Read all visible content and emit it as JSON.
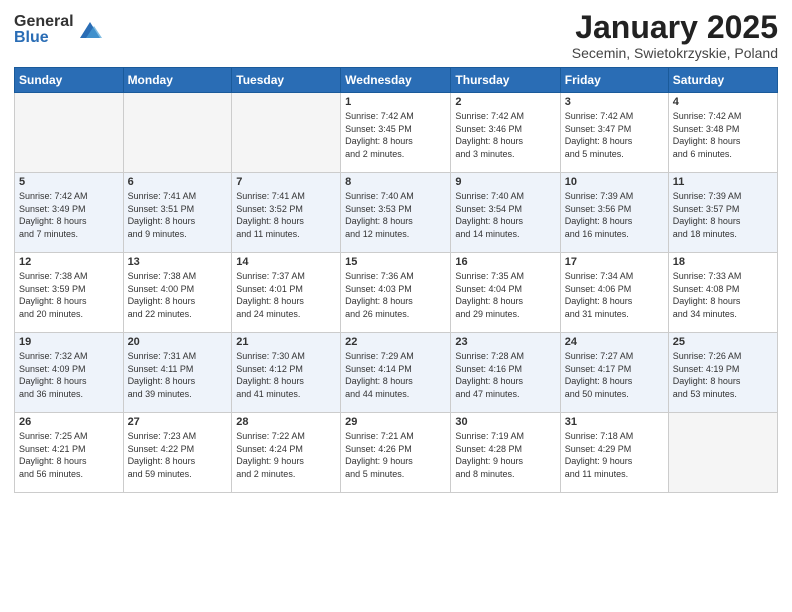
{
  "logo": {
    "general": "General",
    "blue": "Blue"
  },
  "title": "January 2025",
  "subtitle": "Secemin, Swietokrzyskie, Poland",
  "days_header": [
    "Sunday",
    "Monday",
    "Tuesday",
    "Wednesday",
    "Thursday",
    "Friday",
    "Saturday"
  ],
  "weeks": [
    [
      {
        "day": "",
        "info": ""
      },
      {
        "day": "",
        "info": ""
      },
      {
        "day": "",
        "info": ""
      },
      {
        "day": "1",
        "info": "Sunrise: 7:42 AM\nSunset: 3:45 PM\nDaylight: 8 hours\nand 2 minutes."
      },
      {
        "day": "2",
        "info": "Sunrise: 7:42 AM\nSunset: 3:46 PM\nDaylight: 8 hours\nand 3 minutes."
      },
      {
        "day": "3",
        "info": "Sunrise: 7:42 AM\nSunset: 3:47 PM\nDaylight: 8 hours\nand 5 minutes."
      },
      {
        "day": "4",
        "info": "Sunrise: 7:42 AM\nSunset: 3:48 PM\nDaylight: 8 hours\nand 6 minutes."
      }
    ],
    [
      {
        "day": "5",
        "info": "Sunrise: 7:42 AM\nSunset: 3:49 PM\nDaylight: 8 hours\nand 7 minutes."
      },
      {
        "day": "6",
        "info": "Sunrise: 7:41 AM\nSunset: 3:51 PM\nDaylight: 8 hours\nand 9 minutes."
      },
      {
        "day": "7",
        "info": "Sunrise: 7:41 AM\nSunset: 3:52 PM\nDaylight: 8 hours\nand 11 minutes."
      },
      {
        "day": "8",
        "info": "Sunrise: 7:40 AM\nSunset: 3:53 PM\nDaylight: 8 hours\nand 12 minutes."
      },
      {
        "day": "9",
        "info": "Sunrise: 7:40 AM\nSunset: 3:54 PM\nDaylight: 8 hours\nand 14 minutes."
      },
      {
        "day": "10",
        "info": "Sunrise: 7:39 AM\nSunset: 3:56 PM\nDaylight: 8 hours\nand 16 minutes."
      },
      {
        "day": "11",
        "info": "Sunrise: 7:39 AM\nSunset: 3:57 PM\nDaylight: 8 hours\nand 18 minutes."
      }
    ],
    [
      {
        "day": "12",
        "info": "Sunrise: 7:38 AM\nSunset: 3:59 PM\nDaylight: 8 hours\nand 20 minutes."
      },
      {
        "day": "13",
        "info": "Sunrise: 7:38 AM\nSunset: 4:00 PM\nDaylight: 8 hours\nand 22 minutes."
      },
      {
        "day": "14",
        "info": "Sunrise: 7:37 AM\nSunset: 4:01 PM\nDaylight: 8 hours\nand 24 minutes."
      },
      {
        "day": "15",
        "info": "Sunrise: 7:36 AM\nSunset: 4:03 PM\nDaylight: 8 hours\nand 26 minutes."
      },
      {
        "day": "16",
        "info": "Sunrise: 7:35 AM\nSunset: 4:04 PM\nDaylight: 8 hours\nand 29 minutes."
      },
      {
        "day": "17",
        "info": "Sunrise: 7:34 AM\nSunset: 4:06 PM\nDaylight: 8 hours\nand 31 minutes."
      },
      {
        "day": "18",
        "info": "Sunrise: 7:33 AM\nSunset: 4:08 PM\nDaylight: 8 hours\nand 34 minutes."
      }
    ],
    [
      {
        "day": "19",
        "info": "Sunrise: 7:32 AM\nSunset: 4:09 PM\nDaylight: 8 hours\nand 36 minutes."
      },
      {
        "day": "20",
        "info": "Sunrise: 7:31 AM\nSunset: 4:11 PM\nDaylight: 8 hours\nand 39 minutes."
      },
      {
        "day": "21",
        "info": "Sunrise: 7:30 AM\nSunset: 4:12 PM\nDaylight: 8 hours\nand 41 minutes."
      },
      {
        "day": "22",
        "info": "Sunrise: 7:29 AM\nSunset: 4:14 PM\nDaylight: 8 hours\nand 44 minutes."
      },
      {
        "day": "23",
        "info": "Sunrise: 7:28 AM\nSunset: 4:16 PM\nDaylight: 8 hours\nand 47 minutes."
      },
      {
        "day": "24",
        "info": "Sunrise: 7:27 AM\nSunset: 4:17 PM\nDaylight: 8 hours\nand 50 minutes."
      },
      {
        "day": "25",
        "info": "Sunrise: 7:26 AM\nSunset: 4:19 PM\nDaylight: 8 hours\nand 53 minutes."
      }
    ],
    [
      {
        "day": "26",
        "info": "Sunrise: 7:25 AM\nSunset: 4:21 PM\nDaylight: 8 hours\nand 56 minutes."
      },
      {
        "day": "27",
        "info": "Sunrise: 7:23 AM\nSunset: 4:22 PM\nDaylight: 8 hours\nand 59 minutes."
      },
      {
        "day": "28",
        "info": "Sunrise: 7:22 AM\nSunset: 4:24 PM\nDaylight: 9 hours\nand 2 minutes."
      },
      {
        "day": "29",
        "info": "Sunrise: 7:21 AM\nSunset: 4:26 PM\nDaylight: 9 hours\nand 5 minutes."
      },
      {
        "day": "30",
        "info": "Sunrise: 7:19 AM\nSunset: 4:28 PM\nDaylight: 9 hours\nand 8 minutes."
      },
      {
        "day": "31",
        "info": "Sunrise: 7:18 AM\nSunset: 4:29 PM\nDaylight: 9 hours\nand 11 minutes."
      },
      {
        "day": "",
        "info": ""
      }
    ]
  ]
}
